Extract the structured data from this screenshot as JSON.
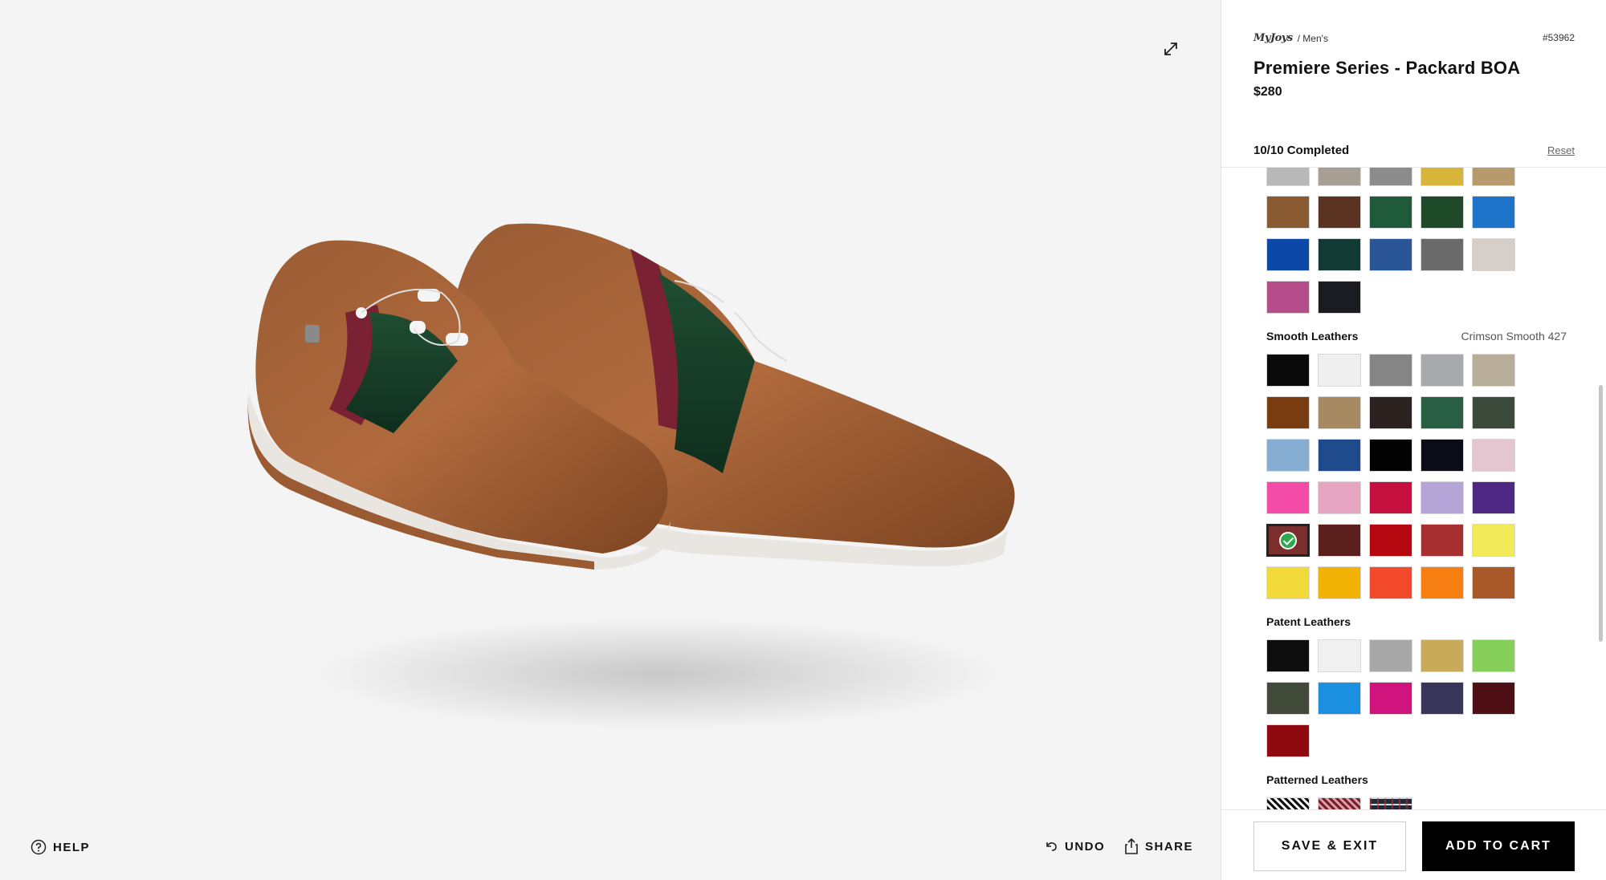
{
  "icons": {
    "expand": "expand-arrows-icon",
    "help": "question-circle-icon",
    "undo": "undo-arrow-icon",
    "share": "share-upload-icon",
    "check": "check-circle-icon"
  },
  "stage": {
    "help_label": "HELP",
    "undo_label": "UNDO",
    "share_label": "SHARE"
  },
  "product": {
    "brand": "MyJoys",
    "category": "/ Men's",
    "sku": "#53962",
    "title": "Premiere Series - Packard BOA",
    "price": "$280",
    "progress": "10/10 Completed",
    "reset_label": "Reset"
  },
  "swatches": {
    "exotic_partial": [
      "#b8b8b8",
      "#a79f94",
      "#8c8c8c",
      "#d7b43a",
      "#b69a6e"
    ],
    "exotic": [
      "#8a5a33",
      "#5b3322",
      "#1f5a3a",
      "#1f4a2a",
      "#1e74c8",
      "#0d47a8",
      "#123a34",
      "#2a5596",
      "#6a6a6a",
      "#d6cfc9",
      "#b54d8b",
      "#1b1b22"
    ],
    "smooth": [
      "#0a0a0a",
      "#efefef",
      "#858585",
      "#a7a9ad",
      "#b7ad98",
      "#7a3d12",
      "#a88a62",
      "#2b221f",
      "#275e44",
      "#3b4a3a",
      "#86aed3",
      "#1f4b8c",
      "#020202",
      "#0c0c18",
      "#e3c6cf",
      "#f44ba8",
      "#e6a6c1",
      "#c40f3f",
      "#b3a3d6",
      "#4f2884",
      "#7a2f2c",
      "#5b1f1d",
      "#b4070f",
      "#a82f2f",
      "#f3ea5a",
      "#f2d93a",
      "#f2b205",
      "#f44a2c",
      "#f77f12",
      "#a9582a"
    ],
    "patent": [
      "#0d0d0d",
      "#f0f0f0",
      "#a8a8a8",
      "#c9a95a",
      "#86cf5a",
      "#424b3a",
      "#1b8fe0",
      "#d0147e",
      "#38345a",
      "#4e1014",
      "#8e0a0e"
    ],
    "patterned": [
      "houndstooth-black",
      "houndstooth-red",
      "plaid-navy"
    ]
  },
  "sections": {
    "smooth_title": "Smooth Leathers",
    "smooth_value": "Crimson Smooth 427",
    "smooth_selected_index": 20,
    "patent_title": "Patent Leathers",
    "patterned_title": "Patterned Leathers"
  },
  "footer": {
    "save_label": "SAVE & EXIT",
    "cart_label": "ADD TO CART"
  }
}
